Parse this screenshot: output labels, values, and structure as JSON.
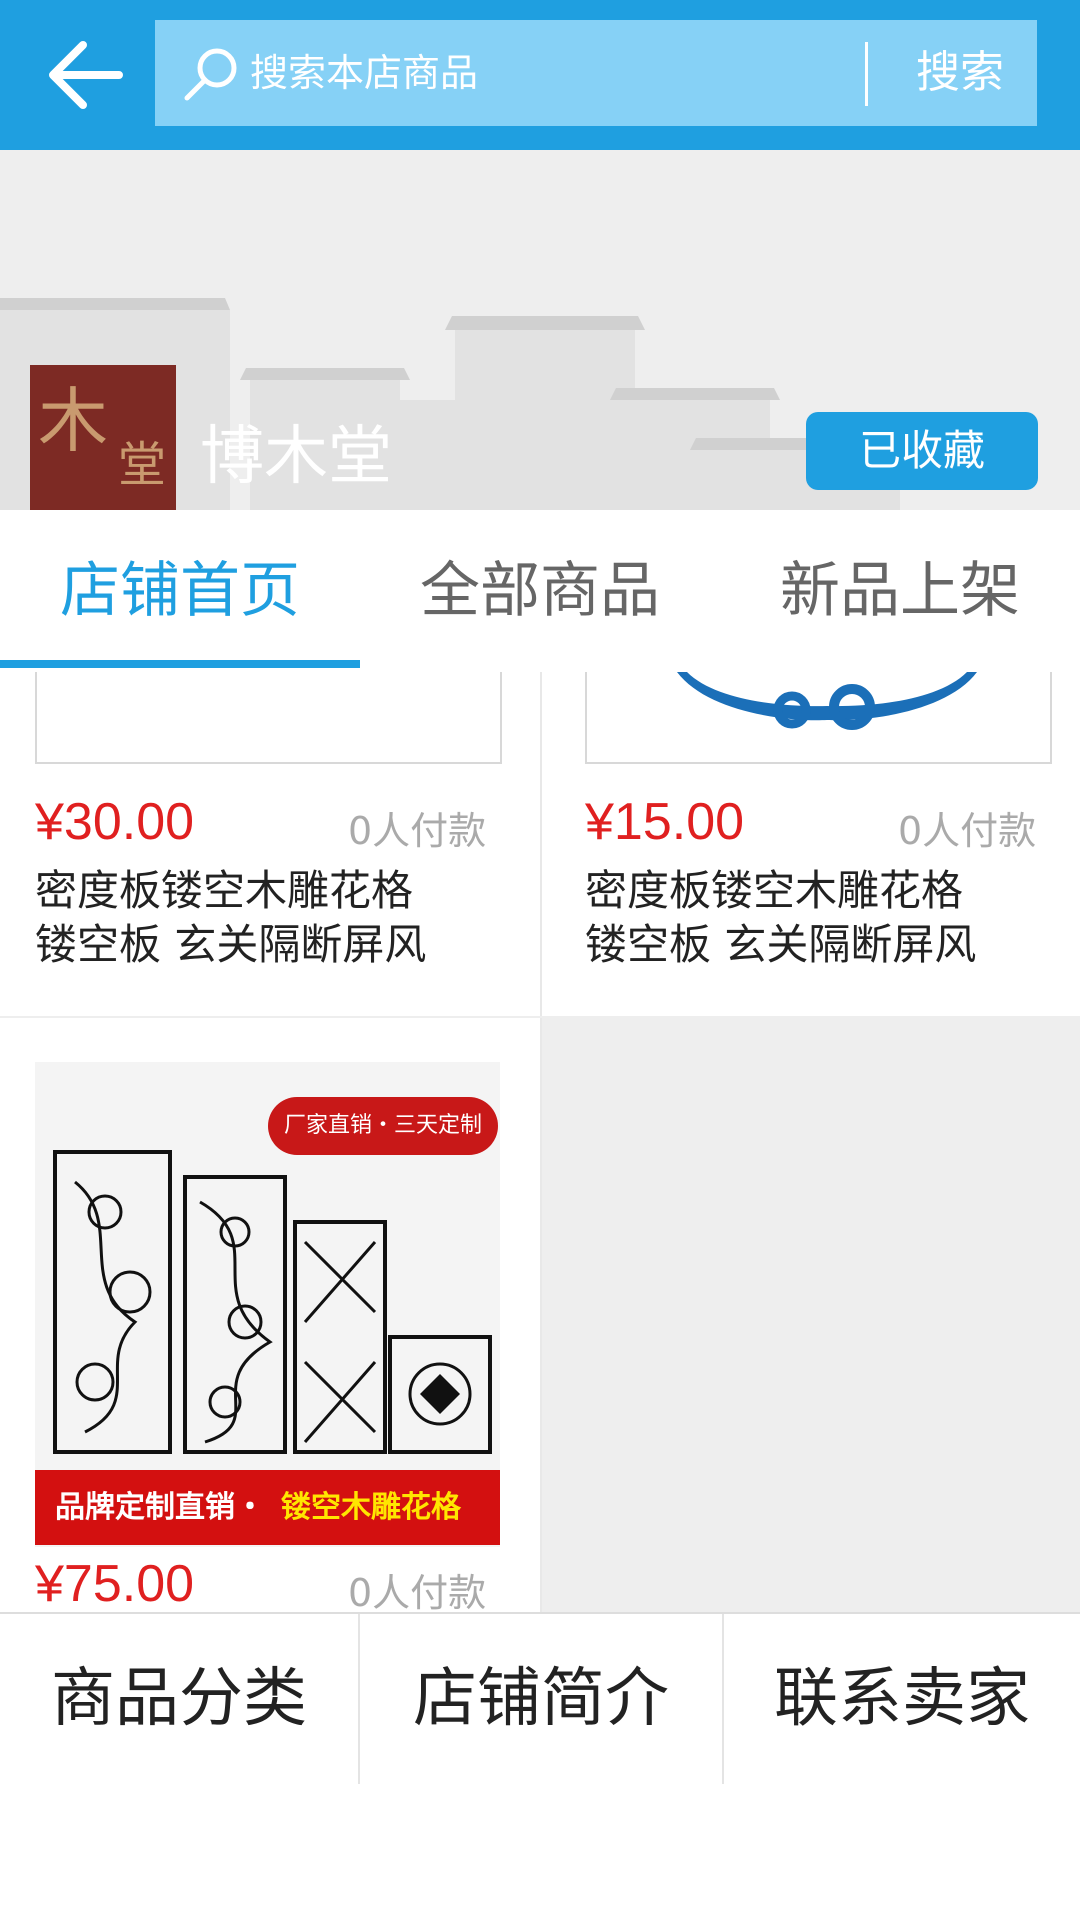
{
  "top_bar": {
    "search_placeholder": "搜索本店商品",
    "search_button": "搜索"
  },
  "store": {
    "logo_text": "博木堂",
    "name": "博木堂",
    "favorite_label": "已收藏"
  },
  "tabs": [
    {
      "label": "店铺首页",
      "active": true
    },
    {
      "label": "全部商品",
      "active": false
    },
    {
      "label": "新品上架",
      "active": false
    }
  ],
  "products": [
    {
      "price": "¥30.00",
      "sold": "0人付款",
      "title_line1": "密度板镂空木雕花格",
      "title_line2": "镂空板 玄关隔断屏风"
    },
    {
      "price": "¥15.00",
      "sold": "0人付款",
      "title_line1": "密度板镂空木雕花格",
      "title_line2": "镂空板 玄关隔断屏风"
    },
    {
      "price": "¥75.00",
      "sold": "0人付款",
      "poster_badge": "厂家直销・三天定制",
      "poster_text_a": "品牌定制直销・",
      "poster_text_b": "镂空木雕花格"
    }
  ],
  "bottom_bar": [
    {
      "label": "商品分类"
    },
    {
      "label": "店铺简介"
    },
    {
      "label": "联系卖家"
    }
  ],
  "colors": {
    "accent": "#1f9fe0",
    "price": "#e02020"
  }
}
